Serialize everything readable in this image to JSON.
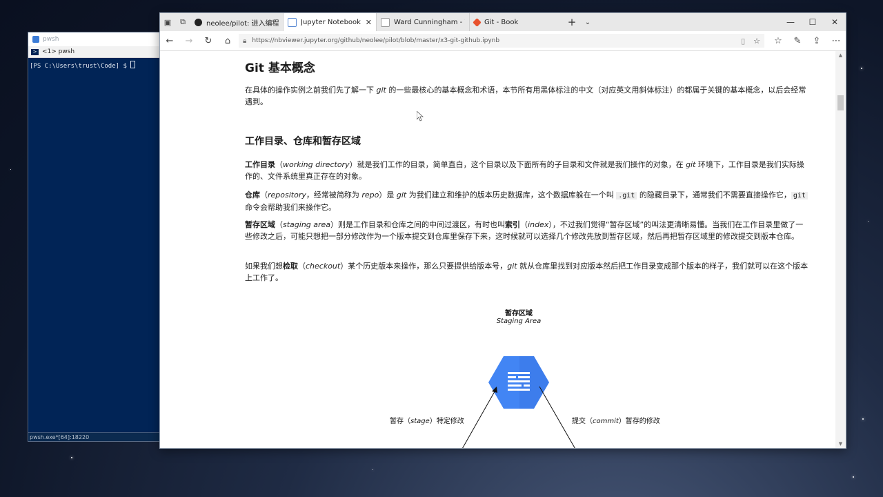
{
  "terminal": {
    "title": "pwsh",
    "tab_label": "<1> pwsh",
    "prompt": "[PS C:\\Users\\trust\\Code] $ ",
    "status": "pwsh.exe*[64]:18220"
  },
  "browser": {
    "tabs": [
      {
        "label": "neolee/pilot: 进入编程世界的",
        "color": "#222222",
        "active": false
      },
      {
        "label": "Jupyter Notebook View",
        "color": "#5b8bd4",
        "active": true
      },
      {
        "label": "Ward Cunningham - Wikipe",
        "color": "#9a9a9a",
        "active": false
      },
      {
        "label": "Git - Book",
        "color": "#e8512c",
        "active": false
      }
    ],
    "url": "https://nbviewer.jupyter.org/github/neolee/pilot/blob/master/x3-git-github.ipynb"
  },
  "doc": {
    "h1": "Git 基本概念",
    "intro": [
      "在具体的操作实例之前我们先了解一下 ",
      "git",
      " 的一些最核心的基本概念和术语，本节所有用黑体标注的中文（对应英文用斜体标注）的都属于关键的基本概念，以后会经常遇到。"
    ],
    "h2": "工作目录、仓库和暂存区域",
    "p1": {
      "term": "工作目录",
      "en": "working directory",
      "a": "）就是我们工作的目录，简单直白，这个目录以及下面所有的子目录和文件就是我们操作的对象，在 ",
      "git": "git",
      "b": " 环境下，工作目录是我们实际操作的、文件系统里真正存在的对象。"
    },
    "p2": {
      "term": "仓库",
      "en": "repository",
      "a": "，经常被简称为 ",
      "repo": "repo",
      "b": "）是 ",
      "git": "git",
      "c": " 为我们建立和维护的版本历史数据库，这个数据库躲在一个叫 ",
      "code1": ".git",
      "d": " 的隐藏目录下，通常我们不需要直接操作它，",
      "code2": "git",
      "e": " 命令会帮助我们来操作它。"
    },
    "p3": {
      "term": "暂存区域",
      "en": "staging area",
      "a": "）则是工作目录和仓库之间的中间过渡区，有时也叫",
      "term2": "索引",
      "en2": "index",
      "b": "），不过我们觉得“暂存区域”的叫法更清晰易懂。当我们在工作目录里做了一些修改之后，可能只想把一部分修改作为一个版本提交到仓库里保存下来，这时候就可以选择几个修改先放到暂存区域，然后再把暂存区域里的修改提交到版本仓库。"
    },
    "p4": {
      "a": "如果我们想",
      "term": "检取",
      "en": "checkout",
      "b": "）某个历史版本来操作，那么只要提供给版本号，",
      "git": "git",
      "c": " 就从仓库里找到对应版本然后把工作目录变成那个版本的样子，我们就可以在这个版本上工作了。"
    },
    "diagram": {
      "top_cn": "暂存区域",
      "top_en": "Staging Area",
      "left_label_a": "暂存（",
      "left_label_en": "stage",
      "left_label_b": "）特定修改",
      "right_label_a": "提交（",
      "right_label_en": "commit",
      "right_label_b": "）暂存的修改",
      "hex_color": "#4285f4",
      "hex_shadow": "#3367d6"
    }
  }
}
